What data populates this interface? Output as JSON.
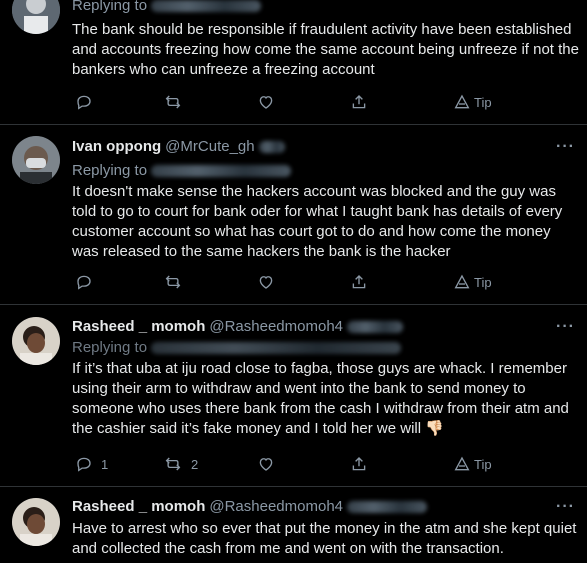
{
  "tweets": [
    {
      "replying_label": "Replying to",
      "body": "The bank should be responsible if fraudulent activity have been established and accounts freezing how come the same account being unfreeze if not the bankers who can unfreeze a freezing account",
      "actions": {
        "reply_count": "",
        "retweet_count": "",
        "like_count": "",
        "tip_label": "Tip"
      }
    },
    {
      "name": "Ivan oppong",
      "handle": "@MrCute_gh",
      "replying_label": "Replying to",
      "body": "It doesn't make sense the hackers account was blocked and the guy was told to go to court for bank oder for what I taught bank has details of every customer account so what has court got to do and how come the money was released to the same hackers the bank is the hacker",
      "actions": {
        "reply_count": "",
        "retweet_count": "",
        "like_count": "",
        "tip_label": "Tip"
      }
    },
    {
      "name": "Rasheed _ momoh",
      "handle": "@Rasheedmomoh4",
      "replying_label": "Replying to",
      "body": "If it’s that uba at iju road close to fagba, those guys are whack. I remember using their arm to withdraw and went into the bank to send money to someone who uses there bank from the cash I withdraw from their atm and the cashier said it’s fake money and I told her we will 👎🏻",
      "actions": {
        "reply_count": "1",
        "retweet_count": "2",
        "like_count": "",
        "tip_label": "Tip"
      }
    },
    {
      "name": "Rasheed _ momoh",
      "handle": "@Rasheedmomoh4",
      "body": "Have to arrest who so ever that put the money in the atm and she kept quiet and collected the cash from me and went on with the transaction."
    }
  ],
  "more_label": "···",
  "icons": {
    "reply": "reply-icon",
    "retweet": "retweet-icon",
    "like": "heart-icon",
    "share": "share-icon",
    "tip": "tip-icon",
    "more": "more-icon"
  },
  "colors": {
    "background": "#000000",
    "text": "#e7e9ea",
    "secondary": "#8b98a5",
    "divider": "#2f3336"
  }
}
